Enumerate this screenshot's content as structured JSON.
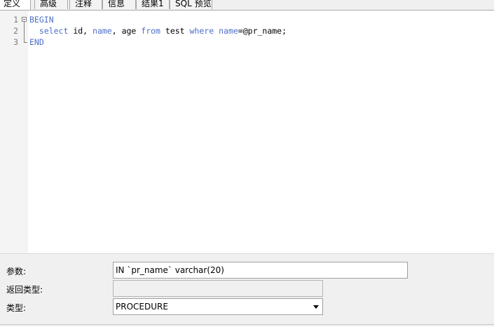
{
  "tabs": [
    {
      "label": "定义",
      "active": true
    },
    {
      "label": "高级",
      "active": false
    },
    {
      "label": "注释",
      "active": false
    },
    {
      "label": "信息",
      "active": false
    },
    {
      "label": "结果1",
      "active": false
    },
    {
      "label": "SQL 预览",
      "active": false
    }
  ],
  "editor": {
    "line_numbers": [
      "1",
      "2",
      "3"
    ],
    "lines": [
      [
        {
          "t": "BEGIN",
          "kw": true
        }
      ],
      [
        {
          "t": "  ",
          "kw": false
        },
        {
          "t": "select",
          "kw": true
        },
        {
          "t": " id, ",
          "kw": false
        },
        {
          "t": "name",
          "kw": true
        },
        {
          "t": ", age ",
          "kw": false
        },
        {
          "t": "from",
          "kw": true
        },
        {
          "t": " test ",
          "kw": false
        },
        {
          "t": "where",
          "kw": true
        },
        {
          "t": " ",
          "kw": false
        },
        {
          "t": "name",
          "kw": true
        },
        {
          "t": "=@pr_name;",
          "kw": false
        }
      ],
      [
        {
          "t": "END",
          "kw": true
        }
      ]
    ],
    "keyword_color": "#4b6ec8"
  },
  "form": {
    "params_label": "参数:",
    "params_value": "IN `pr_name` varchar(20)",
    "return_type_label": "返回类型:",
    "return_type_value": "",
    "type_label": "类型:",
    "type_value": "PROCEDURE"
  }
}
